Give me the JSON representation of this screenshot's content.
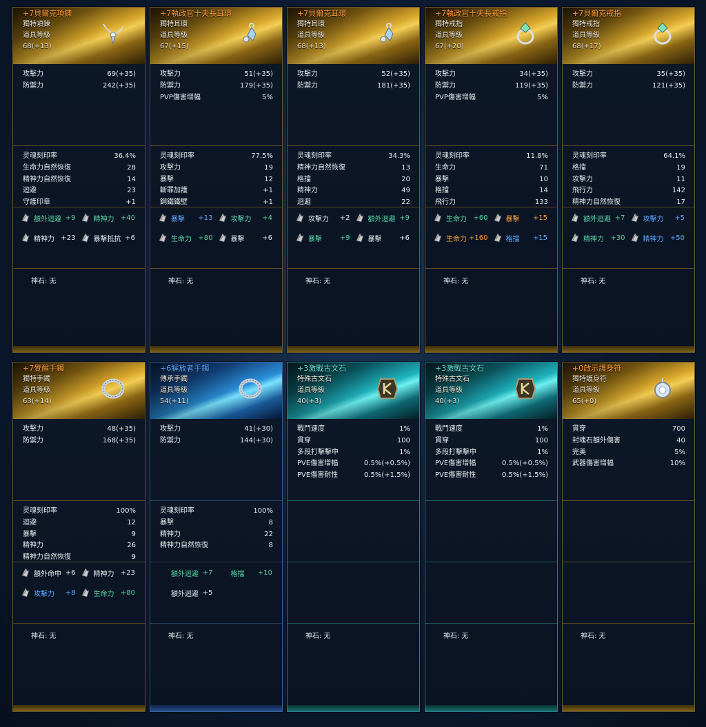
{
  "labels": {
    "god_stone": "神石: 无"
  },
  "colors": {
    "gold": "#d7a62b",
    "blue": "#2a8fd8",
    "cyan": "#1fb4bf",
    "orange_text": "#ff9c3a",
    "green_text": "#58d6a6",
    "blue_text": "#5aa8ff"
  },
  "cards": [
    {
      "theme": "gold",
      "icon": "necklace-icon",
      "name_color": "orange",
      "name": "+7貝爾克項鍊",
      "type": "獨特項鍊",
      "level_label": "道具等級",
      "level": "68(+13)",
      "stats": [
        [
          "攻擊力",
          "69(+35)"
        ],
        [
          "防禦力",
          "242(+35)"
        ]
      ],
      "subs": [
        [
          "灵魂刻印率",
          "36.4%"
        ],
        [
          "生命力自然恢復",
          "28"
        ],
        [
          "精神力自然恢復",
          "14"
        ],
        [
          "迴避",
          "23"
        ],
        [
          "守護印章",
          "+1"
        ]
      ],
      "options": [
        {
          "name": "額外迴避",
          "value": "+9",
          "color": "green"
        },
        {
          "name": "精神力",
          "value": "+40",
          "color": "green"
        },
        {
          "name": "精神力",
          "value": "+23",
          "color": "white"
        },
        {
          "name": "暴擊抵抗",
          "value": "+6",
          "color": "white"
        }
      ]
    },
    {
      "theme": "gold",
      "icon": "earring-icon",
      "name_color": "orange",
      "name": "+7執政官十夫長耳環",
      "type": "獨特耳環",
      "level_label": "道具等級",
      "level": "67(+15)",
      "stats": [
        [
          "攻擊力",
          "51(+35)"
        ],
        [
          "防禦力",
          "179(+35)"
        ],
        [
          "PVP傷害增幅",
          "5%"
        ]
      ],
      "subs": [
        [
          "灵魂刻印率",
          "77.5%"
        ],
        [
          "攻擊力",
          "19"
        ],
        [
          "暴擊",
          "12"
        ],
        [
          "斷罪加護",
          "+1"
        ],
        [
          "鋼鐵鐵壁",
          "+1"
        ]
      ],
      "options": [
        {
          "name": "暴擊",
          "value": "+13",
          "color": "blue"
        },
        {
          "name": "攻擊力",
          "value": "+4",
          "color": "green"
        },
        {
          "name": "生命力",
          "value": "+80",
          "color": "green"
        },
        {
          "name": "暴擊",
          "value": "+6",
          "color": "white"
        }
      ]
    },
    {
      "theme": "gold",
      "icon": "earring-icon",
      "name_color": "orange",
      "name": "+7貝爾克耳環",
      "type": "獨特耳環",
      "level_label": "道具等級",
      "level": "68(+13)",
      "stats": [
        [
          "攻擊力",
          "52(+35)"
        ],
        [
          "防禦力",
          "181(+35)"
        ]
      ],
      "subs": [
        [
          "灵魂刻印率",
          "34.3%"
        ],
        [
          "精神力自然恢復",
          "13"
        ],
        [
          "格擋",
          "20"
        ],
        [
          "精神力",
          "49"
        ],
        [
          "迴避",
          "22"
        ]
      ],
      "options": [
        {
          "name": "攻擊力",
          "value": "+2",
          "color": "white"
        },
        {
          "name": "額外迴避",
          "value": "+9",
          "color": "green"
        },
        {
          "name": "暴擊",
          "value": "+9",
          "color": "green"
        },
        {
          "name": "暴擊",
          "value": "+6",
          "color": "white"
        }
      ]
    },
    {
      "theme": "gold",
      "icon": "ring-icon",
      "name_color": "orange",
      "name": "+7執政官十夫長戒指",
      "type": "獨特戒指",
      "level_label": "道具等級",
      "level": "67(+20)",
      "stats": [
        [
          "攻擊力",
          "34(+35)"
        ],
        [
          "防禦力",
          "119(+35)"
        ],
        [
          "PVP傷害增幅",
          "5%"
        ]
      ],
      "subs": [
        [
          "灵魂刻印率",
          "11.8%"
        ],
        [
          "生命力",
          "71"
        ],
        [
          "暴擊",
          "10"
        ],
        [
          "格擋",
          "14"
        ],
        [
          "飛行力",
          "133"
        ]
      ],
      "options": [
        {
          "name": "生命力",
          "value": "+60",
          "color": "green"
        },
        {
          "name": "暴擊",
          "value": "+15",
          "color": "orange"
        },
        {
          "name": "生命力",
          "value": "+160",
          "color": "orange"
        },
        {
          "name": "格擋",
          "value": "+15",
          "color": "blue"
        }
      ]
    },
    {
      "theme": "gold",
      "icon": "ring-icon",
      "name_color": "orange",
      "name": "+7貝爾克戒指",
      "type": "獨特戒指",
      "level_label": "道具等級",
      "level": "68(+17)",
      "stats": [
        [
          "攻擊力",
          "35(+35)"
        ],
        [
          "防禦力",
          "121(+35)"
        ]
      ],
      "subs": [
        [
          "灵魂刻印率",
          "64.1%"
        ],
        [
          "格擋",
          "19"
        ],
        [
          "攻擊力",
          "11"
        ],
        [
          "飛行力",
          "142"
        ],
        [
          "精神力自然恢復",
          "17"
        ]
      ],
      "options": [
        {
          "name": "額外迴避",
          "value": "+7",
          "color": "green"
        },
        {
          "name": "攻擊力",
          "value": "+5",
          "color": "blue"
        },
        {
          "name": "精神力",
          "value": "+30",
          "color": "green"
        },
        {
          "name": "精神力",
          "value": "+50",
          "color": "blue"
        }
      ]
    },
    {
      "theme": "gold",
      "icon": "bracelet-icon",
      "name_color": "orange",
      "name": "+7覺醒手鐲",
      "type": "獨特手鐲",
      "level_label": "道具等級",
      "level": "63(+14)",
      "stats": [
        [
          "攻擊力",
          "48(+35)"
        ],
        [
          "防禦力",
          "168(+35)"
        ]
      ],
      "subs": [
        [
          "灵魂刻印率",
          "100%"
        ],
        [
          "迴避",
          "12"
        ],
        [
          "暴擊",
          "9"
        ],
        [
          "精神力",
          "26"
        ],
        [
          "精神力自然恢復",
          "9"
        ]
      ],
      "options": [
        {
          "name": "額外命中",
          "value": "+6",
          "color": "white"
        },
        {
          "name": "精神力",
          "value": "+23",
          "color": "white"
        },
        {
          "name": "攻擊力",
          "value": "+8",
          "color": "blue"
        },
        {
          "name": "生命力",
          "value": "+80",
          "color": "green"
        }
      ]
    },
    {
      "theme": "blue",
      "icon": "bracelet-icon",
      "name_color": "blue",
      "name": "+6解放者手鐲",
      "type": "傳承手鐲",
      "level_label": "道具等級",
      "level": "54(+11)",
      "stats": [
        [
          "攻擊力",
          "41(+30)"
        ],
        [
          "防禦力",
          "144(+30)"
        ]
      ],
      "subs": [
        [
          "灵魂刻印率",
          "100%"
        ],
        [
          "暴擊",
          "8"
        ],
        [
          "精神力",
          "22"
        ],
        [
          "精神力自然恢復",
          "8"
        ]
      ],
      "options": [
        {
          "name": "額外迴避",
          "value": "+7",
          "color": "green",
          "noicon": true
        },
        {
          "name": "格擋",
          "value": "+10",
          "color": "green",
          "noicon": true
        },
        {
          "name": "額外迴避",
          "value": "+5",
          "color": "white",
          "noicon": true
        }
      ]
    },
    {
      "theme": "cyan",
      "icon": "rune-icon",
      "name_color": "cyan",
      "name": "+3激戰古文石",
      "type": "特殊古文石",
      "level_label": "道具等級",
      "level": "40(+3)",
      "stats": [
        [
          "戰鬥速度",
          "1%"
        ],
        [
          "貫穿",
          "100"
        ],
        [
          "多段打擊擊中",
          "1%"
        ],
        [
          "PVE傷害增幅",
          "0.5%(+0.5%)"
        ],
        [
          "PVE傷害耐性",
          "0.5%(+1.5%)"
        ]
      ],
      "subs": [],
      "options": []
    },
    {
      "theme": "cyan",
      "icon": "rune-icon",
      "name_color": "cyan",
      "name": "+3激戰古文石",
      "type": "特殊古文石",
      "level_label": "道具等級",
      "level": "40(+3)",
      "stats": [
        [
          "戰鬥速度",
          "1%"
        ],
        [
          "貫穿",
          "100"
        ],
        [
          "多段打擊擊中",
          "1%"
        ],
        [
          "PVE傷害增幅",
          "0.5%(+0.5%)"
        ],
        [
          "PVE傷害耐性",
          "0.5%(+1.5%)"
        ]
      ],
      "subs": [],
      "options": []
    },
    {
      "theme": "gold",
      "icon": "amulet-icon",
      "name_color": "orange",
      "name": "+0啟示護身符",
      "type": "獨特護身符",
      "level_label": "道具等級",
      "level": "65(+0)",
      "stats": [
        [
          "貫穿",
          "700"
        ],
        [
          "封魂石額外傷害",
          "40"
        ],
        [
          "完美",
          "5%"
        ],
        [
          "武器傷害增幅",
          "10%"
        ]
      ],
      "subs": [],
      "options": []
    }
  ]
}
